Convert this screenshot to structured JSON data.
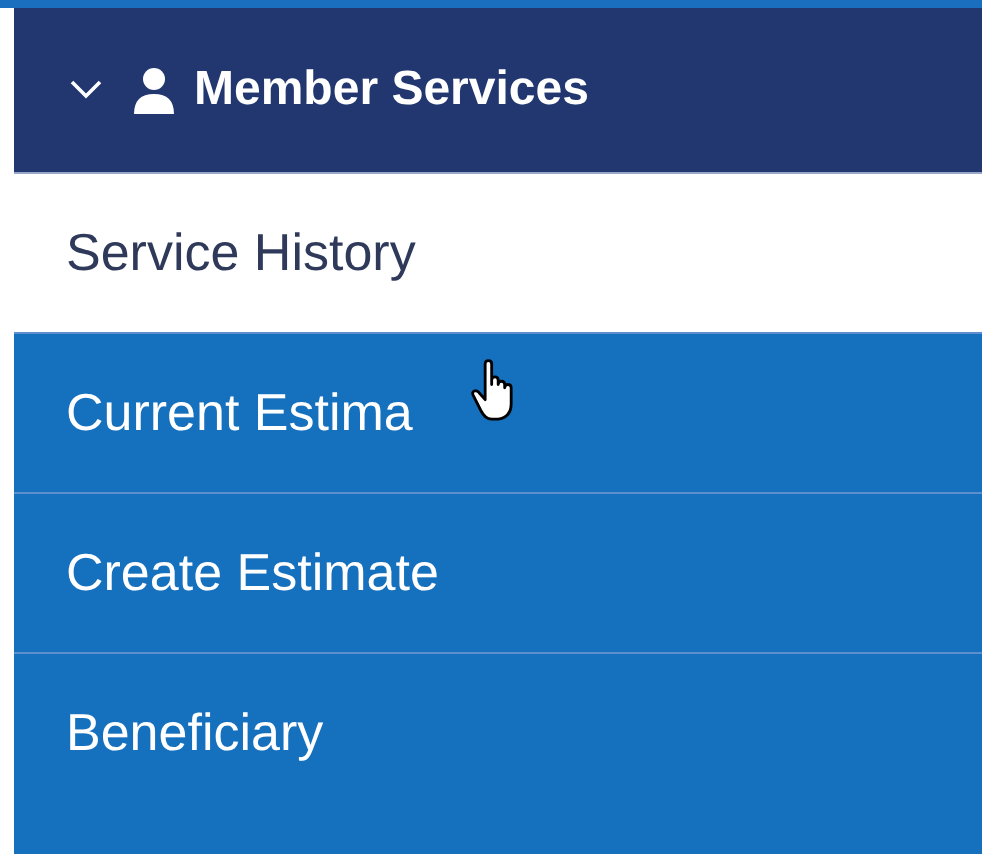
{
  "menu": {
    "title": "Member Services",
    "expanded": true,
    "items": [
      {
        "label": "Service History",
        "selected": true
      },
      {
        "label": "Current Estima",
        "selected": false,
        "hovered": true
      },
      {
        "label": "Create Estimate",
        "selected": false
      },
      {
        "label": "Beneficiary",
        "selected": false
      }
    ]
  }
}
